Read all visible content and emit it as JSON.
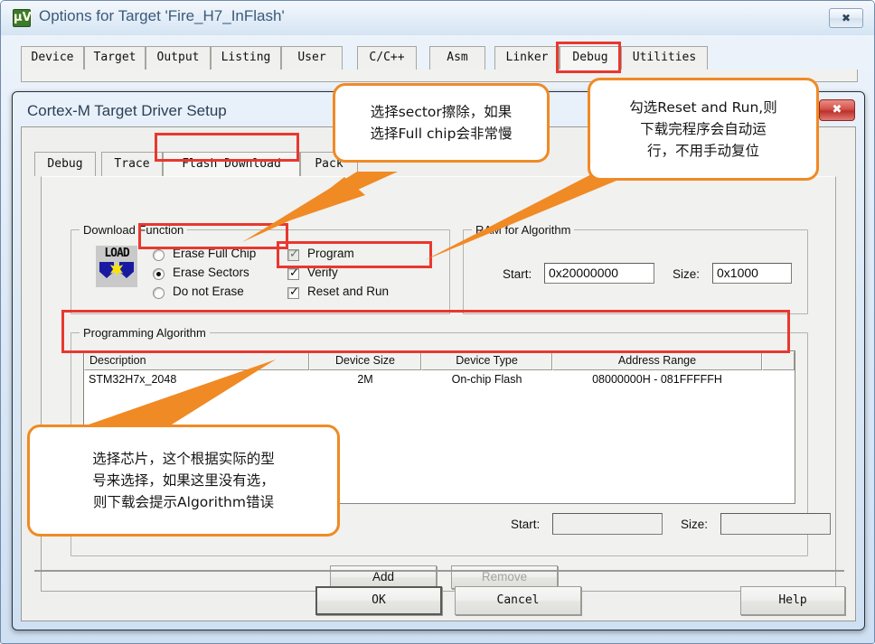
{
  "outer_window": {
    "title": "Options for Target 'Fire_H7_InFlash'",
    "icon": "keil-uvision-icon",
    "close_label": "✖",
    "tabs": [
      {
        "label": "Device",
        "active": false
      },
      {
        "label": "Target",
        "active": false
      },
      {
        "label": "Output",
        "active": false
      },
      {
        "label": "Listing",
        "active": false
      },
      {
        "label": "User",
        "active": false
      },
      {
        "label": "C/C++",
        "active": false
      },
      {
        "label": "Asm",
        "active": false
      },
      {
        "label": "Linker",
        "active": false
      },
      {
        "label": "Debug",
        "active": true
      },
      {
        "label": "Utilities",
        "active": false
      }
    ]
  },
  "dialog": {
    "title": "Cortex-M Target Driver Setup",
    "close_label": "✖",
    "tabs": [
      {
        "label": "Debug",
        "active": false
      },
      {
        "label": "Trace",
        "active": false
      },
      {
        "label": "Flash Download",
        "active": true
      },
      {
        "label": "Pack",
        "active": false
      }
    ],
    "download_function": {
      "group_label": "Download Function",
      "icon": "load-flash-icon",
      "icon_text": "LOAD",
      "radios": [
        {
          "label": "Erase Full Chip",
          "checked": false
        },
        {
          "label": "Erase Sectors",
          "checked": true
        },
        {
          "label": "Do not Erase",
          "checked": false
        }
      ],
      "checkboxes": [
        {
          "label": "Program",
          "checked": true,
          "dim": true
        },
        {
          "label": "Verify",
          "checked": true,
          "dim": false
        },
        {
          "label": "Reset and Run",
          "checked": true,
          "dim": false
        }
      ]
    },
    "ram_for_algorithm": {
      "group_label": "RAM for Algorithm",
      "start_label": "Start:",
      "start_value": "0x20000000",
      "size_label": "Size:",
      "size_value": "0x1000"
    },
    "programming_algorithm": {
      "group_label": "Programming Algorithm",
      "columns": [
        "Description",
        "Device Size",
        "Device Type",
        "Address Range",
        ""
      ],
      "rows": [
        {
          "description": "STM32H7x_2048",
          "device_size": "2M",
          "device_type": "On-chip Flash",
          "address_range": "08000000H - 081FFFFFH"
        }
      ],
      "start_label": "Start:",
      "start_value": "",
      "size_label": "Size:",
      "size_value": "",
      "add_label": "Add",
      "remove_label": "Remove"
    },
    "footer": {
      "ok_label": "OK",
      "cancel_label": "Cancel",
      "help_label": "Help"
    }
  },
  "annotations": [
    {
      "id": "callout-erase-sectors",
      "text": "选择sector擦除，如果\n选择Full chip会非常慢"
    },
    {
      "id": "callout-reset-and-run",
      "text": "勾选Reset and Run,则\n下载完程序会自动运\n行，不用手动复位"
    },
    {
      "id": "callout-select-chip",
      "text": "选择芯片，这个根据实际的型\n号来选择，如果这里没有选，\n则下载会提示Algorithm错误"
    }
  ],
  "colors": {
    "highlight_red": "#e8382f",
    "callout_orange": "#f08a24",
    "dialog_titlebar_blue": "#2b3f55"
  }
}
